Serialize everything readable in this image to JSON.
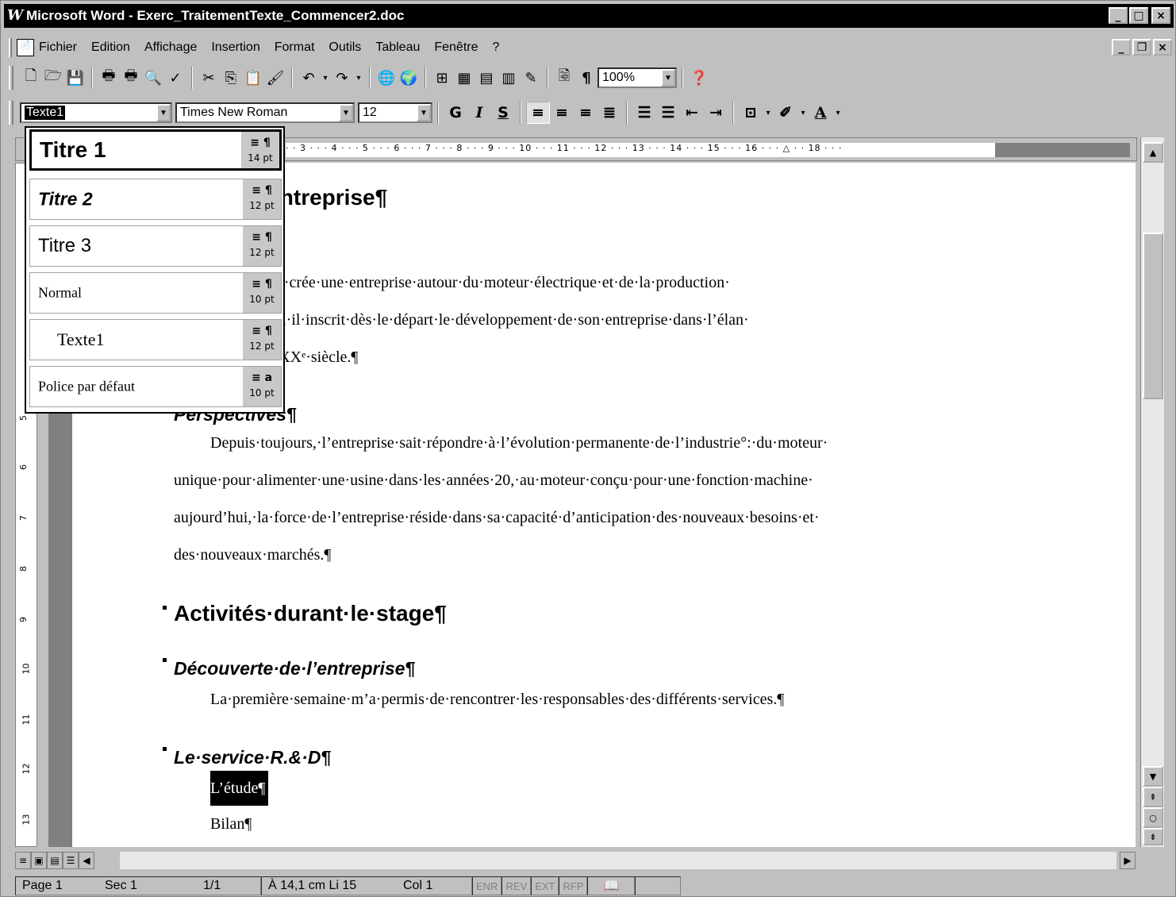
{
  "window": {
    "title": "Microsoft Word - Exerc_TraitementTexte_Commencer2.doc",
    "app_icon": "W",
    "buttons": [
      "_",
      "□",
      "×"
    ]
  },
  "menubar": {
    "items": [
      "Fichier",
      "Edition",
      "Affichage",
      "Insertion",
      "Format",
      "Outils",
      "Tableau",
      "Fenêtre",
      "?"
    ]
  },
  "toolbar_standard": {
    "zoom": "100%"
  },
  "toolbar_format": {
    "style": "Texte1",
    "font": "Times New Roman",
    "size": "12",
    "bold": "G",
    "italic": "I",
    "underline": "S"
  },
  "style_dropdown": {
    "items": [
      {
        "name": "Titre 1",
        "symbol": "≡ ¶",
        "size": "14 pt"
      },
      {
        "name": "Titre 2",
        "symbol": "≡ ¶",
        "size": "12 pt"
      },
      {
        "name": "Titre 3",
        "symbol": "≡ ¶",
        "size": "12 pt"
      },
      {
        "name": "Normal",
        "symbol": "≡ ¶",
        "size": "10 pt"
      },
      {
        "name": "Texte1",
        "symbol": "≡ ¶",
        "size": "12 pt"
      },
      {
        "name": "Police par défaut",
        "symbol": "≡ a",
        "size": "10 pt"
      }
    ]
  },
  "ruler": {
    "marks": "· · 3 · · · 4 · · · 5 · · · 6 · · · 7 · · · 8 · · · 9 · · · 10 · · · 11 · · · 12 · · · 13 · · · 14 · · · 15 · · · 16 · · · △ · · 18 · · ·",
    "vertical": [
      "5",
      "6",
      "7",
      "8",
      "9",
      "10",
      "11",
      "12",
      "13"
    ]
  },
  "document": {
    "h1_partial": "tion·de·l’entreprise¶",
    "h2_partial": "¶",
    "p1_l1": "·Marcellin·Leroy·crée·une·entreprise·autour·du·moteur·électrique·et·de·la·production·",
    "p1_l2": "écurseur·inventif,·il·inscrit·dès·le·départ·le·développement·de·son·entreprise·dans·l’élan·",
    "p1_l3": "chnologique·du·XXᵉ·siècle.¶",
    "h2_perspectives": "Perspectives¶",
    "p2_l1": "Depuis·toujours,·l’entreprise·sait·répondre·à·l’évolution·permanente·de·l’industrie°:·du·moteur·",
    "p2_l2": "unique·pour·alimenter·une·usine·dans·les·années·20,·au·moteur·conçu·pour·une·fonction·machine·",
    "p2_l3": "aujourd’hui,·la·force·de·l’entreprise·réside·dans·sa·capacité·d’anticipation·des·nouveaux·besoins·et·",
    "p2_l4": "des·nouveaux·marchés.¶",
    "h1_activites": "Activités·durant·le·stage¶",
    "h2_decouverte": "Découverte·de·l’entreprise¶",
    "p3": "La·première·semaine·m’a·permis·de·rencontrer·les·responsables·des·différents·services.¶",
    "h2_service": "Le·service·R.&·D¶",
    "etude": "L’étude¶",
    "bilan": "Bilan¶"
  },
  "statusbar": {
    "page": "Page 1",
    "sec": "Sec 1",
    "pages": "1/1",
    "pos": "À 14,1 cm Li 15",
    "col": "Col 1",
    "modes": [
      "ENR",
      "REV",
      "EXT",
      "RFP"
    ]
  }
}
